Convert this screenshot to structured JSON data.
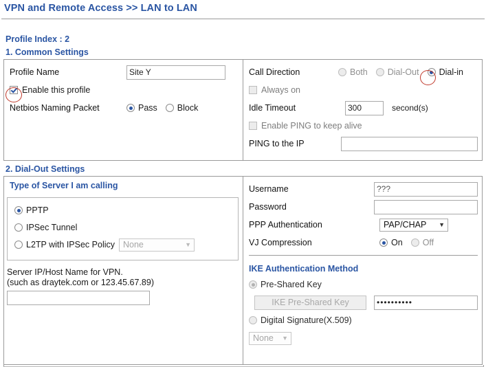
{
  "header": {
    "breadcrumb": "VPN and Remote Access >> LAN to LAN"
  },
  "profile": {
    "index_label": "Profile Index : 2"
  },
  "common_settings": {
    "section_title": "1. Common Settings",
    "profile_name_label": "Profile Name",
    "profile_name_value": "Site Y",
    "enable_profile_label": "Enable this profile",
    "enable_profile_checked": true,
    "netbios_label": "Netbios Naming Packet",
    "netbios_options": [
      "Pass",
      "Block"
    ],
    "netbios_selected": "Pass",
    "call_direction_label": "Call Direction",
    "call_direction_options": [
      "Both",
      "Dial-Out",
      "Dial-in"
    ],
    "call_direction_selected": "Dial-in",
    "always_on_label": "Always on",
    "always_on_checked": false,
    "idle_timeout_label": "Idle Timeout",
    "idle_timeout_value": "300",
    "idle_timeout_unit": "second(s)",
    "enable_ping_label": "Enable PING to keep alive",
    "enable_ping_checked": false,
    "ping_ip_label": "PING to the IP",
    "ping_ip_value": ""
  },
  "dial_out_settings": {
    "section_title": "2. Dial-Out Settings",
    "server_type_title": "Type of Server I am calling",
    "server_type_options": [
      "PPTP",
      "IPSec Tunnel",
      "L2TP with IPSec Policy"
    ],
    "server_type_selected": "PPTP",
    "l2tp_policy_value": "None",
    "l2tp_policy_options": [
      "None"
    ],
    "server_ip_hint_line1": "Server IP/Host Name for VPN.",
    "server_ip_hint_line2": "(such as draytek.com or 123.45.67.89)",
    "server_ip_value": "",
    "username_label": "Username",
    "username_value": "???",
    "password_label": "Password",
    "password_value": "",
    "ppp_auth_label": "PPP Authentication",
    "ppp_auth_value": "PAP/CHAP",
    "ppp_auth_options": [
      "PAP/CHAP"
    ],
    "vj_compression_label": "VJ Compression",
    "vj_compression_options": [
      "On",
      "Off"
    ],
    "vj_compression_selected": "On",
    "ike_title": "IKE Authentication Method",
    "ike_preshared_label": "Pre-Shared Key",
    "ike_preshared_selected": true,
    "ike_preshared_button_label": "IKE Pre-Shared Key",
    "ike_preshared_key_value": "••••••••••",
    "ike_digital_signature_label": "Digital Signature(X.509)",
    "ike_digital_signature_selected": false,
    "ike_cert_value": "None",
    "ike_cert_options": [
      "None"
    ]
  },
  "colors": {
    "heading_blue": "#2a55a3",
    "annotation_red": "#c0392b",
    "border_grey": "#9a9a9a"
  },
  "annotations": {
    "enable_profile_highlight": "red-ellipse",
    "dial_in_highlight": "red-ellipse"
  }
}
